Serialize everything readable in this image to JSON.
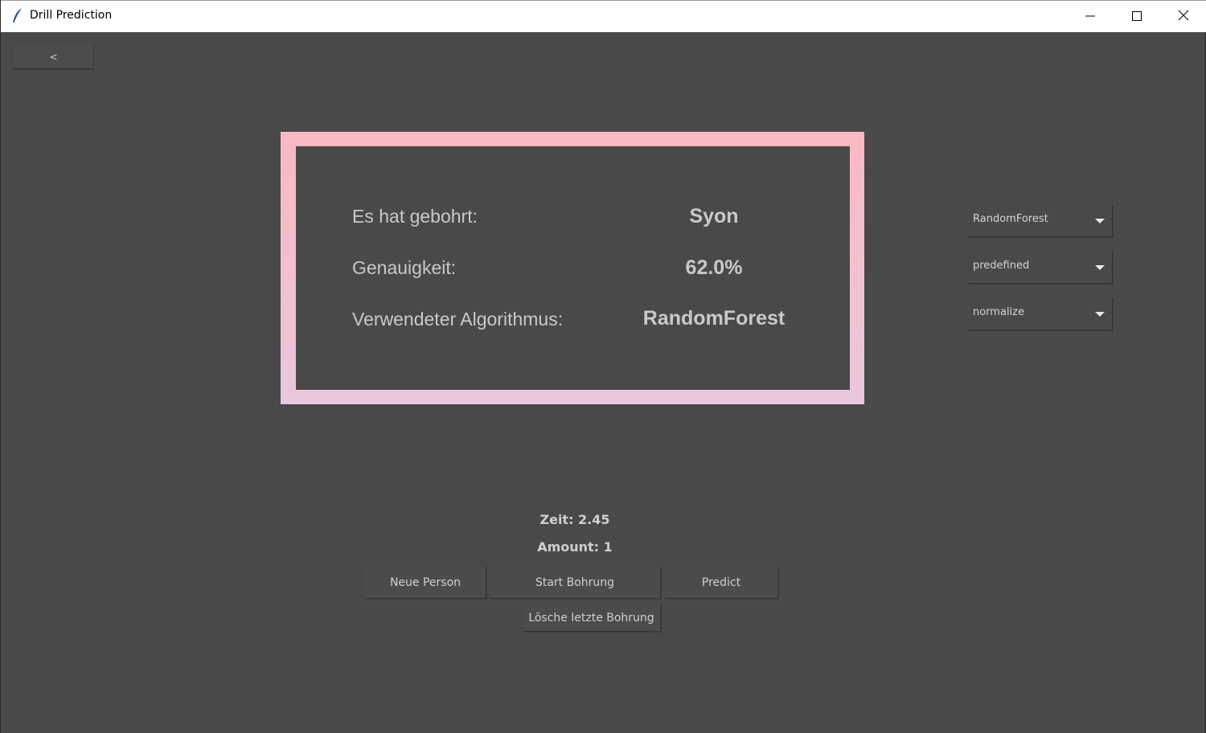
{
  "window": {
    "title": "Drill Prediction"
  },
  "nav": {
    "back_label": "<"
  },
  "result": {
    "rows": [
      {
        "label": "Es hat gebohrt:",
        "value": "Syon"
      },
      {
        "label": "Genauigkeit:",
        "value": "62.0%"
      },
      {
        "label": "Verwendeter Algorithmus:",
        "value": "RandomForest"
      }
    ],
    "frame_colors": {
      "top": "#fbb9c2",
      "bottom": "#e9c7dc"
    }
  },
  "options": {
    "algorithm": "RandomForest",
    "dataset": "predefined",
    "preprocessing": "normalize"
  },
  "status": {
    "time": "Zeit: 2.45",
    "amount": "Amount: 1"
  },
  "actions": {
    "new_person": "Neue Person",
    "start_drilling": "Start Bohrung",
    "predict": "Predict",
    "delete_last": "Lösche letzte Bohrung"
  },
  "icons": {
    "app": "feather-icon",
    "minimize": "minimize-icon",
    "maximize": "maximize-icon",
    "close": "close-icon",
    "dropdown": "chevron-down-icon"
  },
  "colors": {
    "background": "#494949",
    "text": "#c9c9c9"
  }
}
